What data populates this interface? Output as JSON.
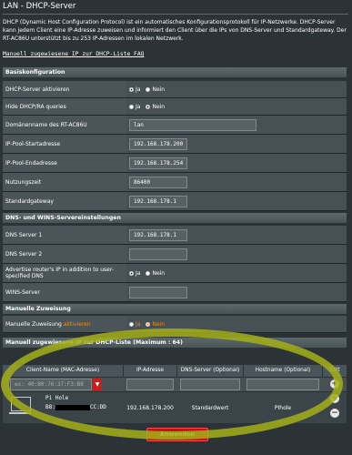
{
  "page": {
    "title": "LAN - DHCP-Server",
    "description": "DHCP (Dynamic Host Configuration Protocol) ist ein automatisches Konfigurationsprotokoll für IP-Netzwerke. DHCP-Server kann jedem Client eine IP-Adresse zuweisen und informiert den Client über die IPs von DNS-Server und Standardgateway. Der RT-AC86U unterstützt bis zu 253 IP-Adressen im lokalen Netzwerk.",
    "faq_link": "Manuell zugewiesene IP zur DHCP-Liste FAQ"
  },
  "basic": {
    "header": "Basiskonfiguration",
    "dhcp_enable": {
      "label": "DHCP-Server aktivieren",
      "yes": "Ja",
      "no": "Nein"
    },
    "hide_dhcp": {
      "label": "Hide DHCP/RA queries",
      "yes": "Ja",
      "no": "Nein"
    },
    "domain": {
      "label": "Domänenname des RT-AC86U",
      "value": "lan"
    },
    "pool_start": {
      "label": "IP-Pool-Startadresse",
      "value": "192.168.178.200"
    },
    "pool_end": {
      "label": "IP-Pool-Endadresse",
      "value": "192.168.178.254"
    },
    "lease": {
      "label": "Nutzungszeit",
      "value": "86400"
    },
    "gateway": {
      "label": "Standardgateway",
      "value": "192.168.178.1"
    }
  },
  "dns": {
    "header": "DNS- und WINS-Servereinstellungen",
    "dns1": {
      "label": "DNS Server 1",
      "value": "192.168.178.1"
    },
    "dns2": {
      "label": "DNS Server 2",
      "value": ""
    },
    "advertise": {
      "label": "Advertise router's IP in addition to user-specified DNS",
      "yes": "Ja",
      "no": "Nein"
    },
    "wins": {
      "label": "WINS-Server",
      "value": ""
    }
  },
  "manual": {
    "header": "Manuelle Zuweisung",
    "enable": {
      "label": "Manuelle Zuweisung",
      "highlight": "aktivieren",
      "yes": "Ja",
      "no": "Nein"
    }
  },
  "list": {
    "header": "Manuell zugewiesene IP zur DHCP-Liste (Maximum : 64)",
    "columns": [
      "Client-Name (MAC-Adresse)",
      "IP-Adresse",
      "DNS-Server (Optional)",
      "Hostname (Optional)",
      "Edit"
    ],
    "mac_placeholder": "ex: 40:B0:76:37:F3:B8",
    "rows": [
      {
        "name": "Pi Hole",
        "mac_prefix": "B8:",
        "mac_suffix": "CC:DD",
        "ip": "192.168.178.200",
        "dns": "Standardwert",
        "hostname": "PIhole"
      }
    ]
  },
  "apply_label": "Anwenden",
  "colors": {
    "accent_orange": "#ff8a00",
    "apply_red": "#c4121a",
    "annotation_yellow": "#a5af19"
  }
}
